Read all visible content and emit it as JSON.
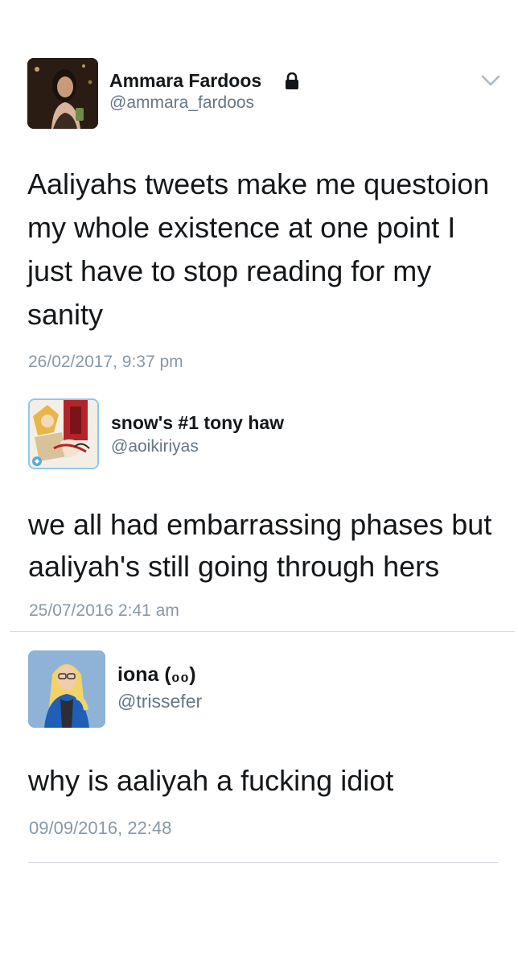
{
  "tweets": [
    {
      "display_name": "Ammara Fardoos",
      "handle": "@ammara_fardoos",
      "protected": true,
      "text": "Aaliyahs tweets make me questoion my whole existence at one point I just have to stop reading for my sanity",
      "timestamp": "26/02/2017, 9:37 pm",
      "menu_icon": "chevron-down-icon",
      "avatar_icon": "avatar-photo-woman"
    },
    {
      "display_name": "snow's #1 tony haw",
      "handle": "@aoikiriyas",
      "text": "we all had embarrassing phases but aaliyah's still going through hers",
      "timestamp": "25/07/2016 2:41 am",
      "avatar_icon": "avatar-anime-art"
    },
    {
      "display_name": "iona (₀₀)",
      "handle": "@trissefer",
      "text": "why is aaliyah a fucking idiot",
      "timestamp": "09/09/2016, 22:48",
      "avatar_icon": "avatar-photo-blonde-woman"
    }
  ],
  "colors": {
    "text_primary": "#14171a",
    "text_secondary": "#657786",
    "timestamp": "#8899a6",
    "divider": "#d8dde2"
  }
}
